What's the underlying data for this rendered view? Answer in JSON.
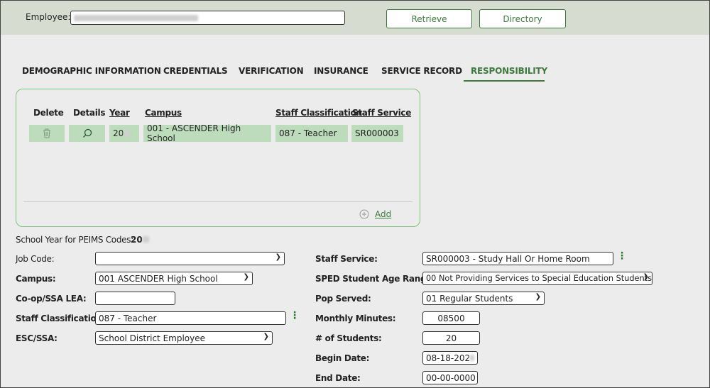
{
  "header": {
    "employee_label": "Employee:",
    "retrieve": "Retrieve",
    "directory": "Directory"
  },
  "tabs": [
    {
      "label": "DEMOGRAPHIC INFORMATION"
    },
    {
      "label": "CREDENTIALS"
    },
    {
      "label": "VERIFICATION"
    },
    {
      "label": "INSURANCE"
    },
    {
      "label": "SERVICE RECORD"
    },
    {
      "label": "RESPONSIBILITY",
      "active": true
    }
  ],
  "grid": {
    "headers": [
      "Delete",
      "Details",
      "Year",
      "Campus",
      "Staff Classification",
      "Staff Service"
    ],
    "rows": [
      {
        "year": "20",
        "campus": "001 - ASCENDER High School",
        "staff_classification": "087 - Teacher",
        "staff_service": "SR000003"
      }
    ],
    "add": "Add"
  },
  "form": {
    "school_year_label": "School Year for PEIMS Codes:",
    "school_year": "20",
    "job_code_label": "Job Code:",
    "job_code": "",
    "campus_label": "Campus:",
    "campus": "001 ASCENDER High School",
    "coop_label": "Co-op/SSA LEA:",
    "coop": "",
    "staff_class_label": "Staff Classification:",
    "staff_class": "087 - Teacher",
    "esc_label": "ESC/SSA:",
    "esc": "School District Employee",
    "staff_service_label": "Staff Service:",
    "staff_service": "SR000003 - Study Hall Or Home Room",
    "sped_label": "SPED Student Age Range:",
    "sped": "00 Not Providing Services to Special Education Students",
    "pop_label": "Pop Served:",
    "pop": "01 Regular Students",
    "minutes_label": "Monthly Minutes:",
    "minutes": "08500",
    "students_label": "# of Students:",
    "students": "20",
    "begin_label": "Begin Date:",
    "begin": "08-18-202",
    "end_label": "End Date:",
    "end": "00-00-0000"
  },
  "colors": {
    "accent": "#3d7a3d",
    "row_bg": "#bcdcbc",
    "header_bg": "#d6ddd0"
  }
}
